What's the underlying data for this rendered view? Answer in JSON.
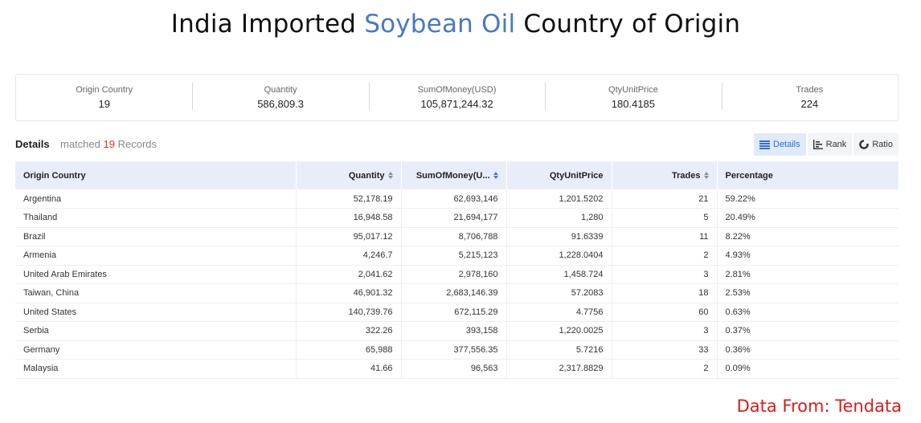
{
  "title": {
    "prefix": "India Imported ",
    "highlight": "Soybean Oil",
    "suffix": " Country of Origin"
  },
  "summary": [
    {
      "label": "Origin Country",
      "value": "19"
    },
    {
      "label": "Quantity",
      "value": "586,809.3"
    },
    {
      "label": "SumOfMoney(USD)",
      "value": "105,871,244.32"
    },
    {
      "label": "QtyUnitPrice",
      "value": "180.4185"
    },
    {
      "label": "Trades",
      "value": "224"
    }
  ],
  "details": {
    "label": "Details",
    "matched_prefix": "matched",
    "matched_count": "19",
    "matched_suffix": "Records"
  },
  "views": {
    "details": "Details",
    "rank": "Rank",
    "ratio": "Ratio"
  },
  "table": {
    "headers": [
      "Origin Country",
      "Quantity",
      "SumOfMoney(U...",
      "QtyUnitPrice",
      "Trades",
      "Percentage"
    ],
    "rows": [
      [
        "Argentina",
        "52,178.19",
        "62,693,146",
        "1,201.5202",
        "21",
        "59.22%"
      ],
      [
        "Thailand",
        "16,948.58",
        "21,694,177",
        "1,280",
        "5",
        "20.49%"
      ],
      [
        "Brazil",
        "95,017.12",
        "8,706,788",
        "91.6339",
        "11",
        "8.22%"
      ],
      [
        "Armenia",
        "4,246.7",
        "5,215,123",
        "1,228.0404",
        "2",
        "4.93%"
      ],
      [
        "United Arab Emirates",
        "2,041.62",
        "2,978,160",
        "1,458.724",
        "3",
        "2.81%"
      ],
      [
        "Taiwan, China",
        "46,901.32",
        "2,683,146.39",
        "57.2083",
        "18",
        "2.53%"
      ],
      [
        "United States",
        "140,739.76",
        "672,115.29",
        "4.7756",
        "60",
        "0.63%"
      ],
      [
        "Serbia",
        "322.26",
        "393,158",
        "1,220.0025",
        "3",
        "0.37%"
      ],
      [
        "Germany",
        "65,988",
        "377,556.35",
        "5.7216",
        "33",
        "0.36%"
      ],
      [
        "Malaysia",
        "41.66",
        "96,563",
        "2,317.8829",
        "2",
        "0.09%"
      ]
    ]
  },
  "source": "Data From: Tendata"
}
